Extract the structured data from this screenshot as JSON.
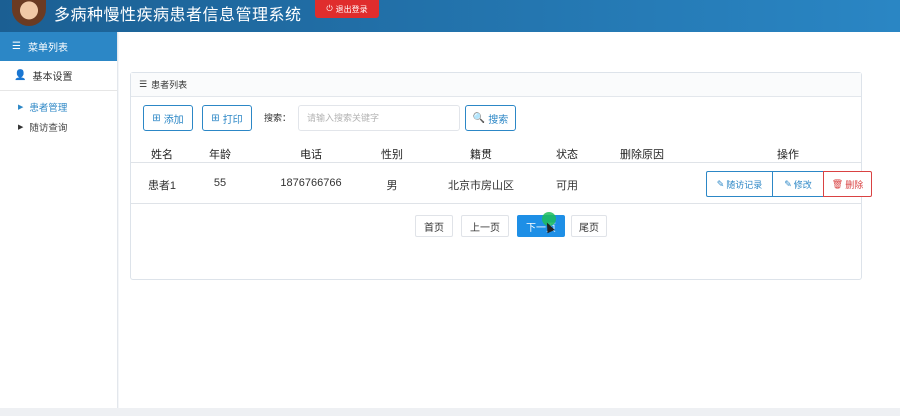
{
  "header": {
    "title": "多病种慢性疾病患者信息管理系统",
    "logout_label": "退出登录"
  },
  "sidebar": {
    "menu_title": "菜单列表",
    "group_label": "基本设置",
    "items": [
      {
        "label": "患者管理",
        "active": true
      },
      {
        "label": "随访查询",
        "active": false
      }
    ]
  },
  "panel": {
    "title": "患者列表",
    "add_label": "添加",
    "print_label": "打印",
    "search_label": "搜索：",
    "search_placeholder": "请输入搜索关键字",
    "search_button": "搜索"
  },
  "table": {
    "columns": [
      "姓名",
      "年龄",
      "电话",
      "性别",
      "籍贯",
      "状态",
      "删除原因",
      "操作"
    ],
    "rows": [
      {
        "name": "患者1",
        "age": "55",
        "phone": "1876766766",
        "gender": "男",
        "origin": "北京市房山区",
        "status": "可用",
        "delete_reason": "",
        "actions": [
          "随访记录",
          "修改",
          "删除"
        ]
      }
    ]
  },
  "pagination": {
    "first": "首页",
    "prev": "上一页",
    "next": "下一页",
    "last": "尾页"
  },
  "colors": {
    "accent": "#2c87c6",
    "danger": "#d94242",
    "primary_button": "#1e8fe6"
  }
}
